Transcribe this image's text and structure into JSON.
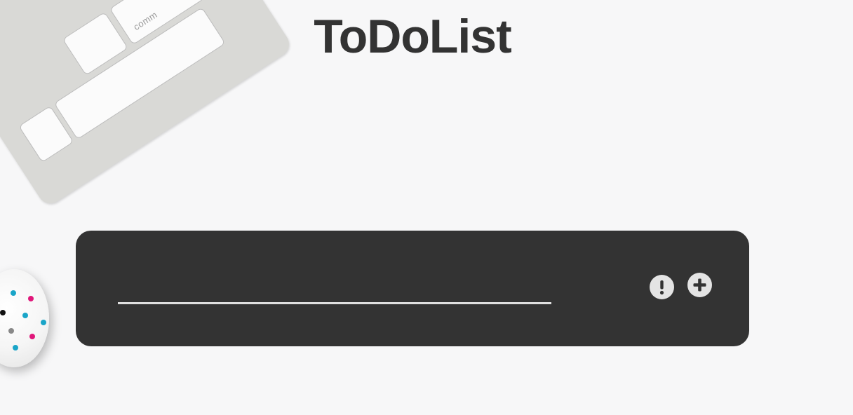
{
  "app": {
    "title": "ToDoList"
  },
  "todo_form": {
    "input_value": "",
    "priority_icon": "exclamation-icon",
    "add_icon": "plus-icon"
  },
  "background": {
    "keyboard_key_label": "comm"
  },
  "colors": {
    "page_background": "#f7f7f8",
    "panel_background": "#333333",
    "title_text": "#333333",
    "icon_button_bg": "#e4e4e4",
    "input_underline": "#e0e0e0"
  }
}
